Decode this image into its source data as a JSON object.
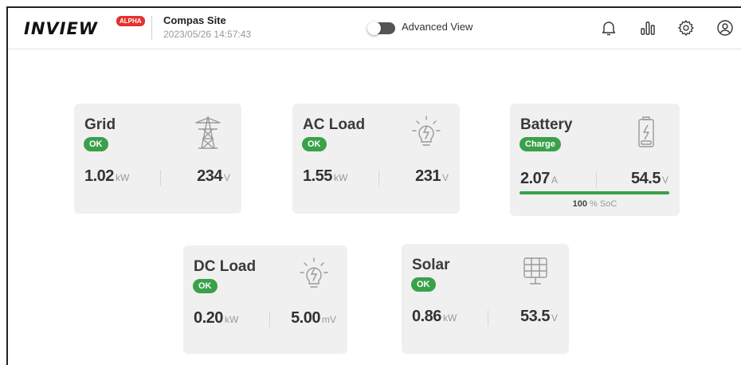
{
  "header": {
    "logo": "INVIEW",
    "badge": "ALPHA",
    "site_name": "Compas Site",
    "site_time": "2023/05/26 14:57:43",
    "advanced_view_label": "Advanced View",
    "advanced_view_on": false,
    "icons": [
      "bell-icon",
      "bar-chart-icon",
      "gear-icon",
      "user-icon"
    ]
  },
  "cards": {
    "grid": {
      "title": "Grid",
      "status": "OK",
      "v1": "1.02",
      "u1": "kW",
      "v2": "234",
      "u2": "V",
      "icon": "transmission-tower-icon"
    },
    "ac_load": {
      "title": "AC Load",
      "status": "OK",
      "v1": "1.55",
      "u1": "kW",
      "v2": "231",
      "u2": "V",
      "icon": "lightbulb-icon"
    },
    "battery": {
      "title": "Battery",
      "status": "Charge",
      "v1": "2.07",
      "u1": "A",
      "v2": "54.5",
      "u2": "V",
      "soc_value": "100",
      "soc_label": "% SoC",
      "soc_fraction": 1.0,
      "icon": "battery-charging-icon"
    },
    "dc_load": {
      "title": "DC Load",
      "status": "OK",
      "v1": "0.20",
      "u1": "kW",
      "v2": "5.00",
      "u2": "mV",
      "icon": "lightbulb-icon"
    },
    "solar": {
      "title": "Solar",
      "status": "OK",
      "v1": "0.86",
      "u1": "kW",
      "v2": "53.5",
      "u2": "V",
      "icon": "solar-panel-icon"
    }
  },
  "colors": {
    "ok_green": "#3aa14a",
    "alpha_red": "#e53030",
    "card_bg": "#f0f0f0"
  }
}
